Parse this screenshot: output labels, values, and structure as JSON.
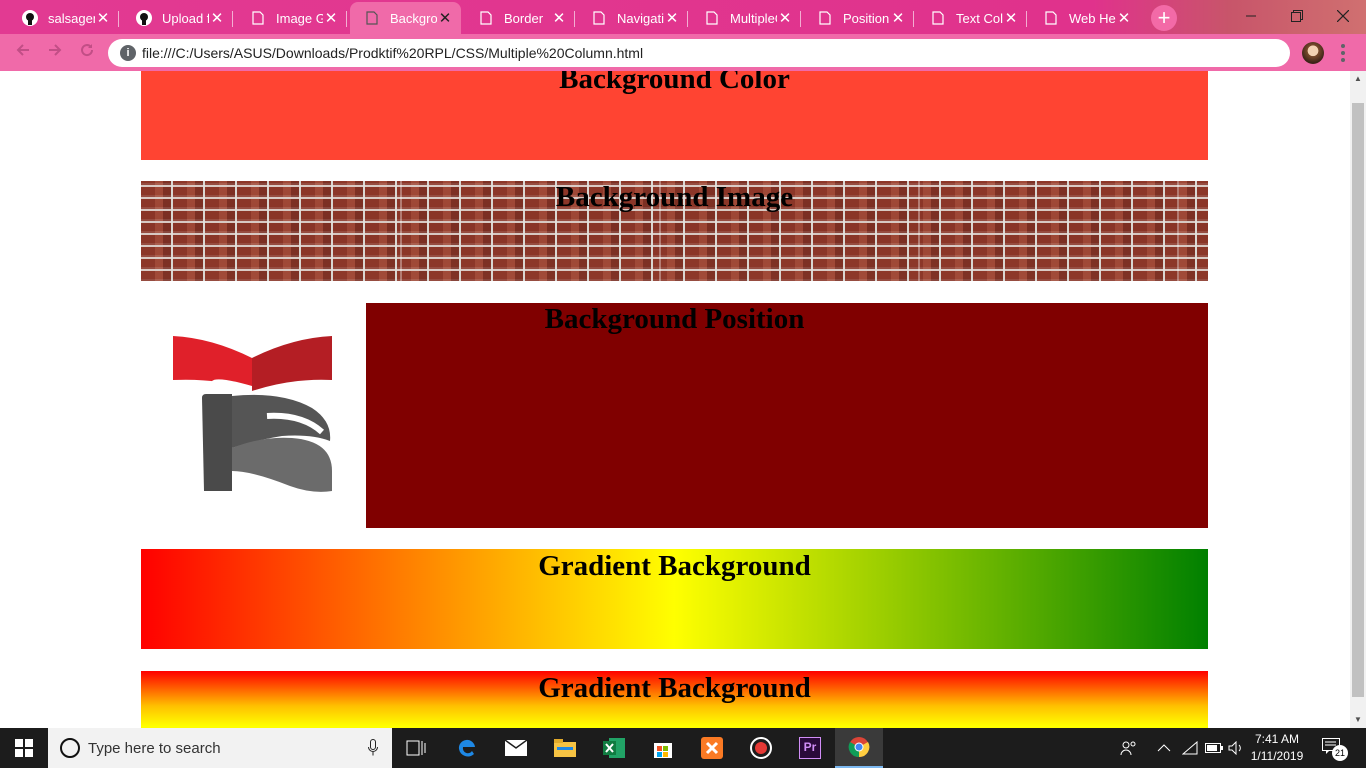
{
  "browser": {
    "tabs": [
      {
        "label": "salsagem",
        "icon": "github-icon",
        "active": false
      },
      {
        "label": "Upload fi",
        "icon": "github-icon",
        "active": false
      },
      {
        "label": "Image Ga",
        "icon": "file-icon",
        "active": false
      },
      {
        "label": "Backgrou",
        "icon": "file-icon",
        "active": true
      },
      {
        "label": "Border",
        "icon": "file-icon",
        "active": false
      },
      {
        "label": "Navigatic",
        "icon": "file-icon",
        "active": false
      },
      {
        "label": "MultipleC",
        "icon": "file-icon",
        "active": false
      },
      {
        "label": "Position I",
        "icon": "file-icon",
        "active": false
      },
      {
        "label": "Text Colo",
        "icon": "file-icon",
        "active": false
      },
      {
        "label": "Web Hen",
        "icon": "file-icon",
        "active": false
      }
    ],
    "new_tab": "+",
    "url": "file:///C:/Users/ASUS/Downloads/Prodktif%20RPL/CSS/Multiple%20Column.html",
    "colors": {
      "tabbar": "#e0318f",
      "toolbar": "#f06aa9",
      "active_tab": "#f06aa9"
    }
  },
  "page": {
    "sections": {
      "color": {
        "heading": "Background Color",
        "bg": "#ff4432"
      },
      "image": {
        "heading": "Background Image"
      },
      "position": {
        "heading": "Background Position",
        "bg": "#800000"
      },
      "gradient1": {
        "heading": "Gradient Background",
        "stops": [
          "#ff0000",
          "#ffff00",
          "#008000"
        ],
        "direction": "horizontal"
      },
      "gradient2": {
        "heading": "Gradient Background",
        "stops": [
          "#ff0000",
          "#ffff00"
        ],
        "direction": "vertical"
      }
    }
  },
  "taskbar": {
    "search_placeholder": "Type here to search",
    "apps": [
      "task-view",
      "edge",
      "mail",
      "file-explorer",
      "excel",
      "store",
      "xampp",
      "recorder",
      "premiere",
      "chrome"
    ],
    "premiere_label": "Pr",
    "time": "7:41 AM",
    "date": "1/11/2019",
    "notification_count": "21"
  }
}
